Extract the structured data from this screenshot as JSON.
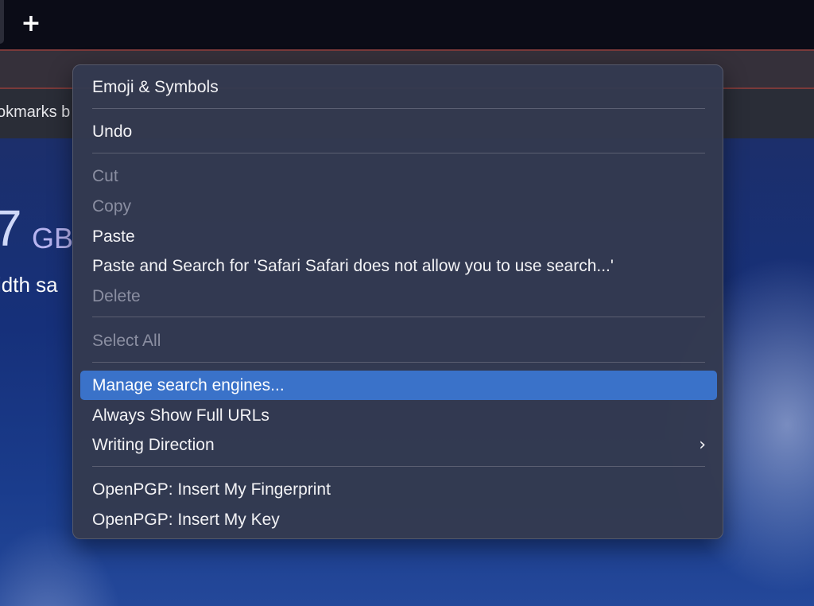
{
  "browser": {
    "new_tab_icon": "+",
    "bookmarks_bar_label": "okmarks b"
  },
  "page": {
    "storage_value": "7",
    "storage_unit": "GB",
    "bandwidth_label": "idth sa"
  },
  "context_menu": {
    "items": [
      {
        "label": "Emoji & Symbols",
        "enabled": true
      },
      {
        "label": "Undo",
        "enabled": true
      },
      {
        "label": "Cut",
        "enabled": false
      },
      {
        "label": "Copy",
        "enabled": false
      },
      {
        "label": "Paste",
        "enabled": true
      },
      {
        "label": "Paste and Search for 'Safari Safari does not allow you to use search...'",
        "enabled": true
      },
      {
        "label": "Delete",
        "enabled": false
      },
      {
        "label": "Select All",
        "enabled": false
      },
      {
        "label": "Manage search engines...",
        "enabled": true,
        "highlighted": true
      },
      {
        "label": "Always Show Full URLs",
        "enabled": true
      },
      {
        "label": "Writing Direction",
        "enabled": true,
        "submenu": true
      },
      {
        "label": "OpenPGP: Insert My Fingerprint",
        "enabled": true
      },
      {
        "label": "OpenPGP: Insert My Key",
        "enabled": true
      }
    ],
    "submenu_icon": "chevron-right-icon",
    "highlight_color": "#3a72c9"
  }
}
